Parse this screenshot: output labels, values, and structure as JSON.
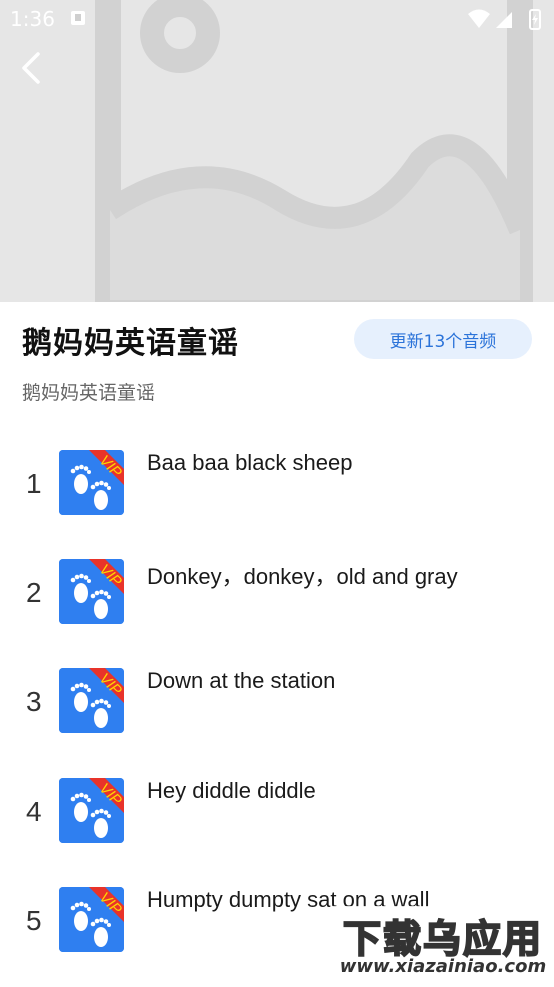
{
  "status_bar": {
    "time": "1:36"
  },
  "album": {
    "title": "鹅妈妈英语童谣",
    "subtitle": "鹅妈妈英语童谣",
    "update_label": "更新13个音频"
  },
  "badge_text": "VIP",
  "tracks": [
    {
      "num": "1",
      "title": "Baa baa black sheep"
    },
    {
      "num": "2",
      "title": "Donkey，donkey，old and gray"
    },
    {
      "num": "3",
      "title": "Down at the station"
    },
    {
      "num": "4",
      "title": "Hey diddle diddle"
    },
    {
      "num": "5",
      "title": "Humpty dumpty sat on a wall"
    }
  ],
  "watermark": {
    "main": "下载乌应用",
    "url": "www.xiazainiao.com"
  },
  "colors": {
    "accent": "#2b73d9",
    "thumb_bg": "#2f7ff0",
    "vip_ribbon": "#e8332a",
    "vip_text": "#ffd400"
  }
}
